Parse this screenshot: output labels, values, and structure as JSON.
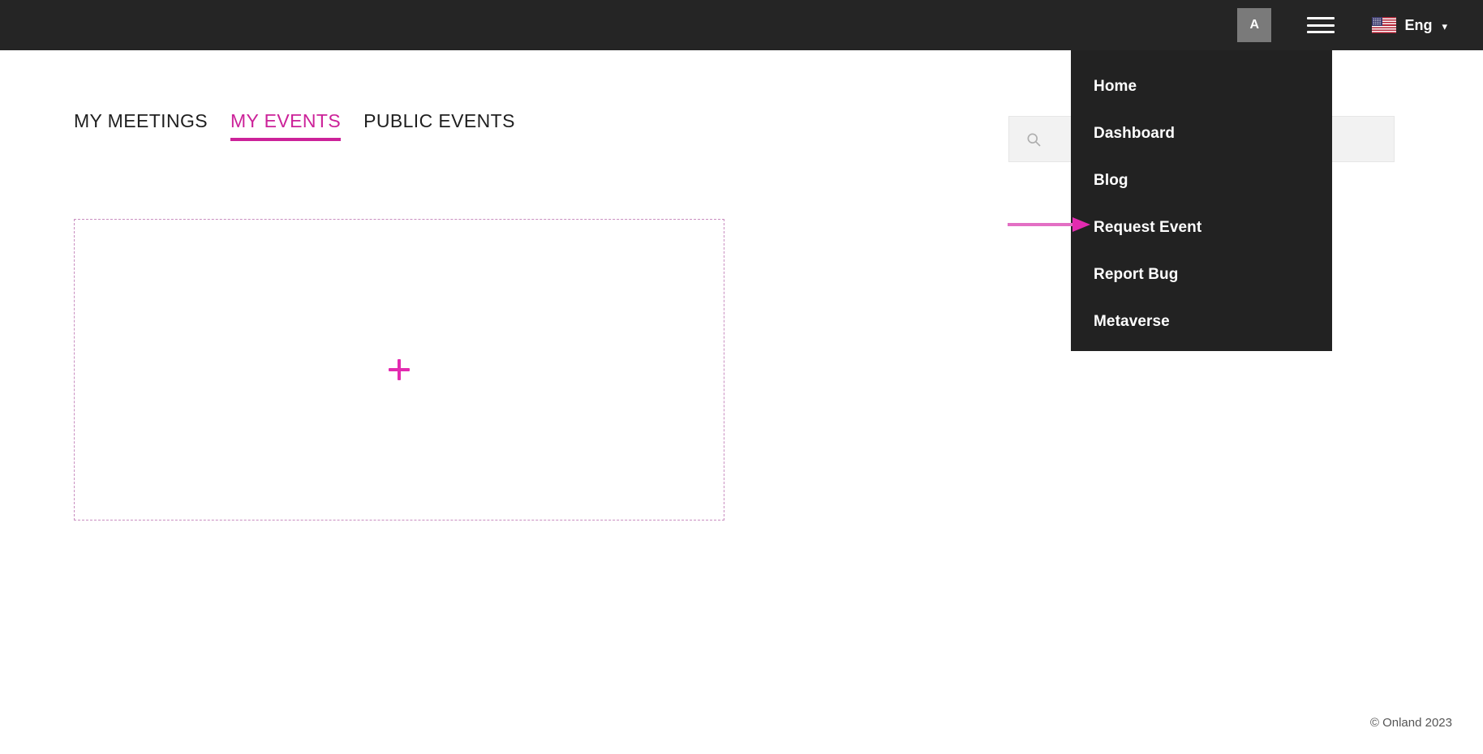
{
  "topbar": {
    "avatar_label": "A",
    "avatar_name": "avatar",
    "menu_icon": "hamburger-menu-icon",
    "language": {
      "flag": "us-flag-icon",
      "label": "Eng",
      "chevron": "chevron-down-icon"
    }
  },
  "dropdown": {
    "open": true,
    "items": [
      {
        "label": "Home"
      },
      {
        "label": "Dashboard"
      },
      {
        "label": "Blog"
      },
      {
        "label": "Request Event"
      },
      {
        "label": "Report Bug"
      },
      {
        "label": "Metaverse"
      }
    ]
  },
  "tabs": [
    {
      "label": "MY MEETINGS",
      "active": false
    },
    {
      "label": "MY EVENTS",
      "active": true
    },
    {
      "label": "PUBLIC EVENTS",
      "active": false
    }
  ],
  "search": {
    "icon": "search-icon",
    "value": "",
    "placeholder": ""
  },
  "dropzone": {
    "icon": "plus-icon",
    "label": ""
  },
  "annotation": {
    "type": "arrow",
    "points_to": "Request Event"
  },
  "footer": {
    "copyright": "© Onland 2023"
  },
  "colors": {
    "topbar_bg": "#252525",
    "dropdown_bg": "#222222",
    "accent": "#CC2299",
    "plus": "#E32BB0",
    "dashed_border": "#C98EC0",
    "search_bg": "#F2F2F2",
    "avatar_bg": "#7A7A7A"
  }
}
